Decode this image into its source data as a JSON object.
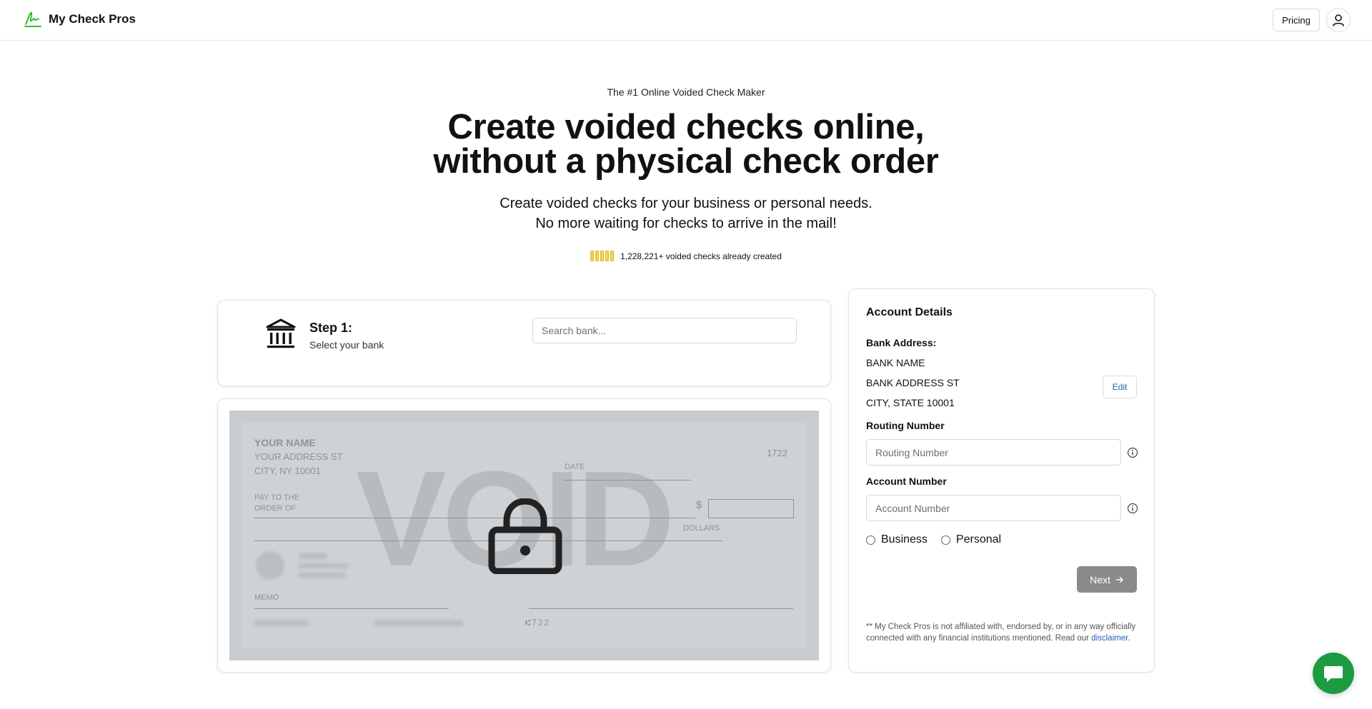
{
  "header": {
    "brand": "My Check Pros",
    "pricing_label": "Pricing"
  },
  "hero": {
    "eyebrow": "The #1 Online Voided Check Maker",
    "headline_line1": "Create voided checks online,",
    "headline_line2": "without a physical check order",
    "subline_line1": "Create voided checks for your business or personal needs.",
    "subline_line2": "No more waiting for checks to arrive in the mail!",
    "stats_text": "1,228,221+ voided checks already created"
  },
  "step": {
    "title": "Step 1:",
    "subtitle": "Select your bank",
    "search_placeholder": "Search bank..."
  },
  "check": {
    "name": "YOUR NAME",
    "address": "YOUR ADDRESS ST",
    "city": "CITY, NY 10001",
    "number": "1722",
    "date_label": "DATE",
    "pay_to_line1": "PAY TO THE",
    "pay_to_line2": "ORDER OF",
    "dollar_sign": "$",
    "dollars_label": "DOLLARS",
    "memo_label": "MEMO",
    "micr_number": "⑆722",
    "void_text": "VOID"
  },
  "account": {
    "title": "Account Details",
    "bank_address_label": "Bank Address:",
    "bank_name": "BANK NAME",
    "bank_street": "BANK ADDRESS ST",
    "bank_city": "CITY, STATE 10001",
    "edit_label": "Edit",
    "routing_label": "Routing Number",
    "routing_placeholder": "Routing Number",
    "account_label": "Account Number",
    "account_placeholder": "Account Number",
    "type_business": "Business",
    "type_personal": "Personal",
    "next_label": "Next",
    "disclaimer_text": "** My Check Pros is not affiliated with, endorsed by, or in any way officially connected with any financial institutions mentioned. Read our ",
    "disclaimer_link": "disclaimer",
    "disclaimer_end": "."
  },
  "colors": {
    "brand_green": "#2fc02f",
    "chat_green": "#1d9b40",
    "link_blue": "#2a5bb8",
    "star_yellow": "#f1d54c",
    "next_disabled": "#8a8a8a"
  },
  "icons": {
    "logo": "signature-logo-icon",
    "user": "user-icon",
    "bank": "bank-icon",
    "lock": "lock-icon",
    "info": "info-icon",
    "arrow": "arrow-right-icon",
    "chat": "chat-icon",
    "stats": "check-stack-icon"
  }
}
